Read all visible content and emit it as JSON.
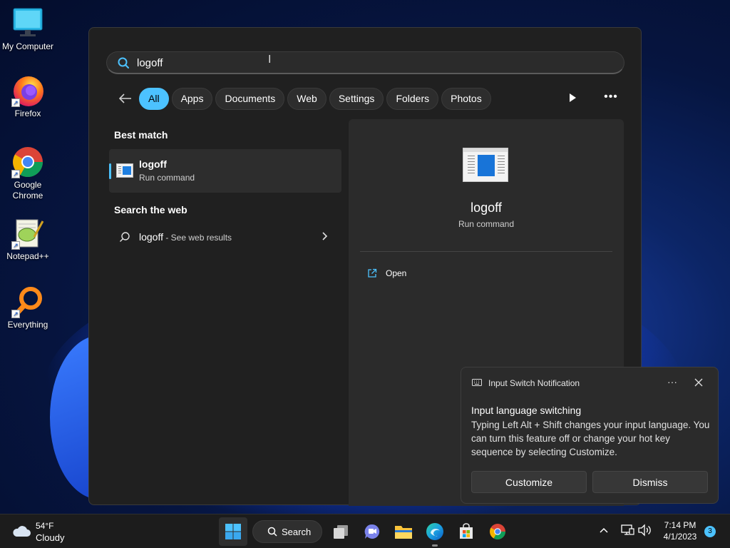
{
  "desktop": {
    "icons": [
      {
        "label": "My Computer"
      },
      {
        "label": "Firefox"
      },
      {
        "label": "Google Chrome"
      },
      {
        "label": "Notepad++"
      },
      {
        "label": "Everything"
      }
    ]
  },
  "search": {
    "query": "logoff"
  },
  "filters": {
    "items": [
      "All",
      "Apps",
      "Documents",
      "Web",
      "Settings",
      "Folders",
      "Photos"
    ],
    "active": "All"
  },
  "results": {
    "best_match_title": "Best match",
    "best_match": {
      "name": "logoff",
      "type": "Run command"
    },
    "web_title": "Search the web",
    "web_item": {
      "query": "logoff",
      "suffix": " - See web results"
    }
  },
  "detail": {
    "name": "logoff",
    "type": "Run command",
    "open_label": "Open"
  },
  "toast": {
    "header": "Input Switch Notification",
    "title": "Input language switching",
    "body": "Typing Left Alt + Shift changes your input language. You can turn this feature off or change your hot key sequence by selecting Customize.",
    "customize_label": "Customize",
    "dismiss_label": "Dismiss"
  },
  "taskbar": {
    "weather_temp": "54°F",
    "weather_cond": "Cloudy",
    "search_label": "Search",
    "time": "7:14 PM",
    "date": "4/1/2023",
    "notification_count": "3"
  },
  "colors": {
    "accent": "#4cc2ff",
    "panel": "#202020",
    "taskbar": "#1c1c1c"
  }
}
